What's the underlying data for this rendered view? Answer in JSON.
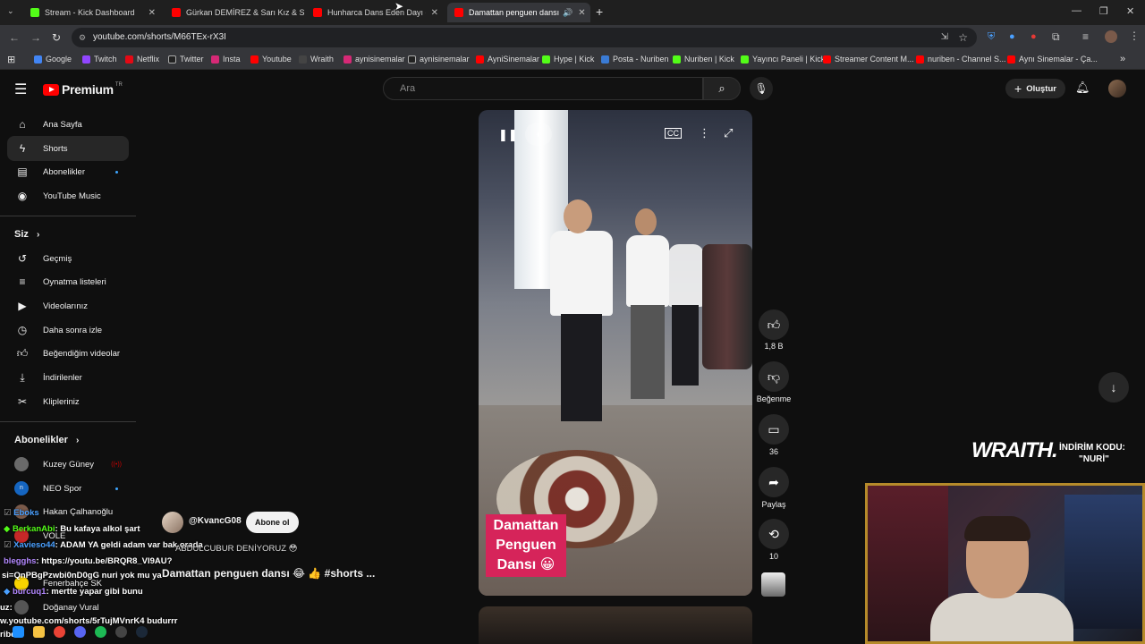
{
  "browser": {
    "tabs": [
      {
        "title": "Stream - Kick Dashboard",
        "color": "#53fc18"
      },
      {
        "title": "Gürkan DEMİREZ & Sarı Kız & S",
        "color": "#ff0000"
      },
      {
        "title": "Hunharca Dans Eden Dayı - You",
        "color": "#ff0000"
      },
      {
        "title": "Damattan penguen dansı",
        "color": "#ff0000"
      }
    ],
    "url": "youtube.com/shorts/M66TEx-rX3I",
    "bookmarks": [
      "Google",
      "Twitch",
      "Netflix",
      "Twitter",
      "Insta",
      "Youtube",
      "Wraith",
      "aynisinemalar",
      "aynisinemalar",
      "AyniSinemalar",
      "Hype | Kick",
      "Posta - Nuriben",
      "Nuriben | Kick",
      "Yayıncı Paneli | Kick",
      "Streamer Content M...",
      "nuriben - Channel S...",
      "Aynı Sinemalar - Ça..."
    ]
  },
  "youtube": {
    "logo": "Premium",
    "region": "TR",
    "search_placeholder": "Ara",
    "create_label": "Oluştur",
    "sidebar_main": [
      {
        "label": "Ana Sayfa",
        "icon": "home-icon"
      },
      {
        "label": "Shorts",
        "icon": "shorts-icon"
      },
      {
        "label": "Abonelikler",
        "icon": "subscriptions-icon"
      },
      {
        "label": "YouTube Music",
        "icon": "music-icon"
      }
    ],
    "you_heading": "Siz",
    "sidebar_you": [
      {
        "label": "Geçmiş",
        "icon": "history-icon"
      },
      {
        "label": "Oynatma listeleri",
        "icon": "playlist-icon"
      },
      {
        "label": "Videolarınız",
        "icon": "video-icon"
      },
      {
        "label": "Daha sonra izle",
        "icon": "clock-icon"
      },
      {
        "label": "Beğendiğim videolar",
        "icon": "thumb-up-icon"
      },
      {
        "label": "İndirilenler",
        "icon": "download-icon"
      },
      {
        "label": "Klipleriniz",
        "icon": "scissors-icon"
      }
    ],
    "subs_heading": "Abonelikler",
    "subscriptions": [
      "Kuzey Güney",
      "NEO Spor",
      "Hakan Çalhanoğlu",
      "VOLE",
      "Fenerbahçe SK",
      "Doğanay Vural"
    ],
    "short": {
      "caption_lines": [
        "Damattan",
        "Penguen",
        "Dansı 😀"
      ],
      "channel": "@KvancG08",
      "subscribe_label": "Abone ol",
      "title": "Damattan penguen dansı 😂 👍 #shorts ...",
      "likes": "1,8 B",
      "dislike_label": "Beğenme",
      "comments": "36",
      "share_label": "Paylaş",
      "remix_count": "10"
    }
  },
  "overlay": {
    "sponsor": "WRAITH.",
    "discount_label": "İNDİRİM KODU:",
    "discount_code": "\"NURİ\"",
    "chat": [
      {
        "user": "Eboks",
        "text": ""
      },
      {
        "user": "BerkanAbi",
        "text": ": Bu kafaya alkol şart"
      },
      {
        "user": "Xavieso44",
        "text": ": ADAM YA geldi adam var bak orada"
      },
      {
        "user": "blegghs",
        "text": ": https://youtu.be/BRQR8_VI9AU?"
      },
      {
        "user": "",
        "text": "si=QnPBgPzwbi0nD0gG nuri yok mu ya"
      },
      {
        "user": "burcuq1",
        "text": ": mertte yapar gibi bunu"
      },
      {
        "user": "uz",
        "text": ":"
      },
      {
        "user": "",
        "text": "w.youtube.com/shorts/5rTujMVnrK4 budurrr"
      },
      {
        "user": "",
        "text": "riben"
      }
    ],
    "chat_extra": "ABDULCUBUR DENİYORUZ 😳"
  }
}
